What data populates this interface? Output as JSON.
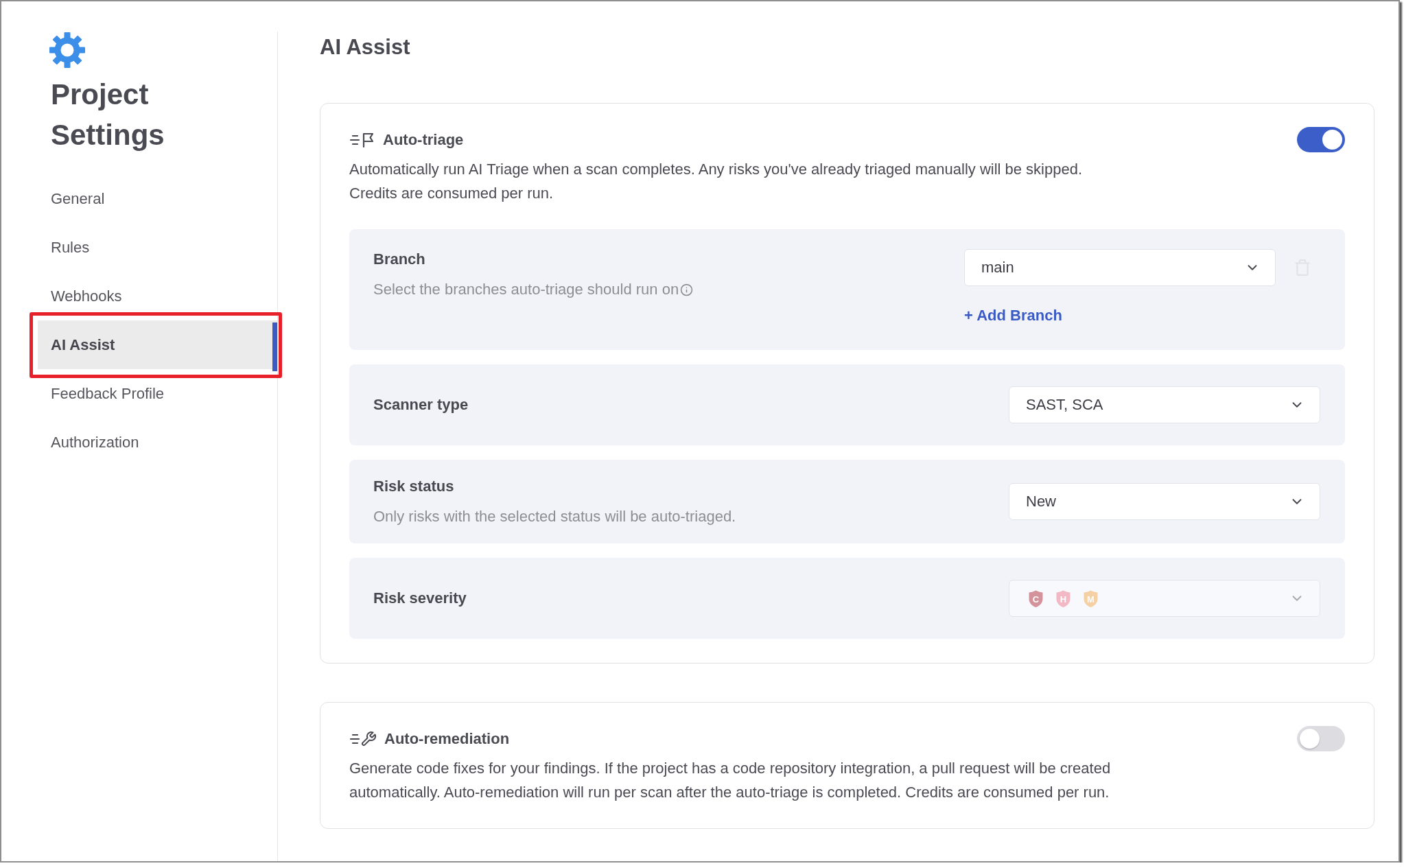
{
  "sidebar": {
    "title": "Project Settings",
    "items": [
      {
        "label": "General",
        "selected": false,
        "outlined": false
      },
      {
        "label": "Rules",
        "selected": false,
        "outlined": false
      },
      {
        "label": "Webhooks",
        "selected": false,
        "outlined": false
      },
      {
        "label": "AI Assist",
        "selected": true,
        "outlined": true
      },
      {
        "label": "Feedback Profile",
        "selected": false,
        "outlined": false
      },
      {
        "label": "Authorization",
        "selected": false,
        "outlined": false
      }
    ]
  },
  "page": {
    "title": "AI Assist"
  },
  "sections": [
    {
      "kind": "triage",
      "title": "Auto-triage",
      "enabled": true,
      "description": "Automatically run AI Triage when a scan completes. Any risks you've already triaged manually will be skipped.\nCredits are consumed per run.",
      "settings": [
        {
          "kind": "branch",
          "label": "Branch",
          "hint": "Select the branches auto-triage should run on",
          "branches": [
            {
              "value": "main",
              "removable": false
            }
          ],
          "add_label": "+ Add Branch"
        },
        {
          "kind": "select",
          "label": "Scanner type",
          "value": "SAST, SCA"
        },
        {
          "kind": "select",
          "label": "Risk status",
          "hint": "Only risks with the selected status will be auto-triaged.",
          "value": "New"
        },
        {
          "kind": "severity",
          "label": "Risk severity",
          "disabled": true,
          "severities": [
            {
              "letter": "C",
              "color": "#d4939a"
            },
            {
              "letter": "H",
              "color": "#f2b8c4"
            },
            {
              "letter": "M",
              "color": "#f5d0a5"
            }
          ]
        }
      ]
    },
    {
      "kind": "remediation",
      "title": "Auto-remediation",
      "enabled": false,
      "description": "Generate code fixes for your findings. If the project has a code repository integration, a pull request will be created\nautomatically. Auto-remediation will run per scan after the auto-triage is completed. Credits are consumed per run."
    }
  ]
}
